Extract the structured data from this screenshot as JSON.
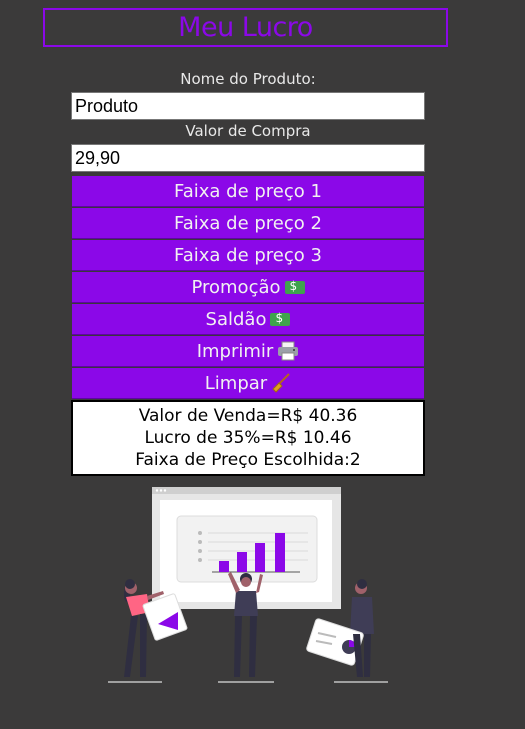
{
  "header": {
    "title": "Meu Lucro"
  },
  "form": {
    "product_label": "Nome do Produto:",
    "product_value": "Produto",
    "price_label": "Valor de Compra",
    "price_value": "29,90"
  },
  "buttons": [
    {
      "label": "Faixa de preço 1"
    },
    {
      "label": "Faixa de preço 2"
    },
    {
      "label": "Faixa de preço 3"
    },
    {
      "label": "Promoção",
      "icon": "money-icon"
    },
    {
      "label": "Saldão",
      "icon": "money-icon"
    },
    {
      "label": "Imprimir",
      "icon": "printer-icon"
    },
    {
      "label": "Limpar",
      "icon": "broom-icon"
    }
  ],
  "result": {
    "line1": "Valor de Venda=R$ 40.36",
    "line2": "Lucro de 35%=R$ 10.46",
    "line3": "Faixa de Preço Escolhida:2"
  },
  "colors": {
    "accent": "#8b08e8",
    "background": "#3b3a3a"
  }
}
